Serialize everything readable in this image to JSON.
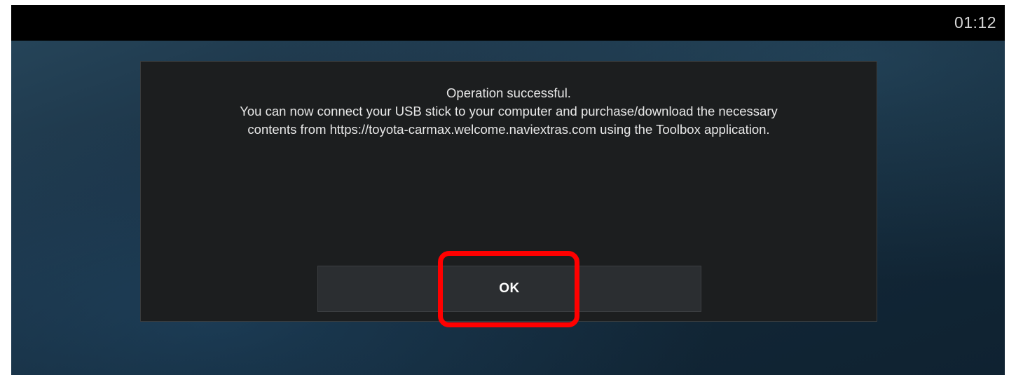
{
  "status_bar": {
    "time": "01:12"
  },
  "dialog": {
    "message_lines": [
      "Operation successful.",
      "You can now connect your USB stick to your computer and purchase/download the necessary",
      "contents from https://toyota-carmax.welcome.naviextras.com using the Toolbox application."
    ],
    "ok_label": "OK"
  },
  "colors": {
    "highlight": "#ff0000",
    "dialog_background": "#1c1e1f",
    "button_background": "#2b2e31",
    "status_bar_background": "#000000"
  }
}
